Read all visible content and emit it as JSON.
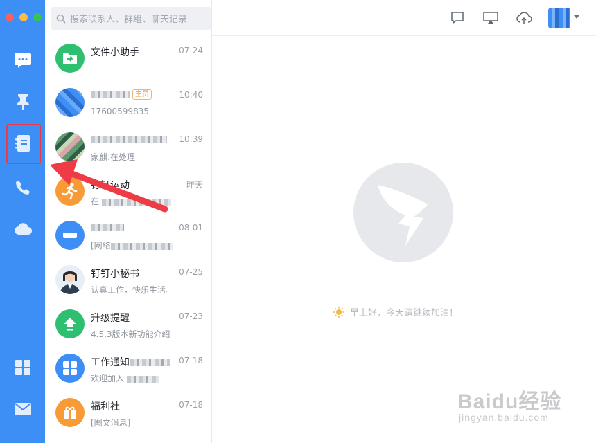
{
  "search": {
    "placeholder": "搜索联系人、群组、聊天记录"
  },
  "sidebar": {
    "items": [
      {
        "name": "messages",
        "icon": "chat-bubble-icon"
      },
      {
        "name": "ding",
        "icon": "pin-icon"
      },
      {
        "name": "contacts",
        "icon": "contacts-book-icon",
        "highlighted": true
      },
      {
        "name": "calls",
        "icon": "phone-icon"
      },
      {
        "name": "cloud",
        "icon": "cloud-icon"
      },
      {
        "name": "workbench",
        "icon": "grid-apps-icon"
      },
      {
        "name": "mail",
        "icon": "mail-icon"
      }
    ]
  },
  "conversations": [
    {
      "name": "文件小助手",
      "time": "07-24",
      "preview": "",
      "avatar": "file-transfer-icon",
      "color": "#2fbf71"
    },
    {
      "name": "",
      "tag": "主员",
      "time": "10:40",
      "preview": "17600599835",
      "avatar": "blurred-avatar",
      "color": "#3d8ef5"
    },
    {
      "name": "",
      "time": "10:39",
      "preview": "家麒:在处理",
      "avatar": "blurred-photo-avatar",
      "color": "#6aa36f"
    },
    {
      "name": "钉钉运动",
      "time": "昨天",
      "preview": "在",
      "avatar": "running-icon",
      "color": "#f89b36"
    },
    {
      "name": "",
      "time": "08-01",
      "preview": "[网络",
      "avatar": "blurred-avatar",
      "color": "#3d8ef5"
    },
    {
      "name": "钉钉小秘书",
      "time": "07-25",
      "preview": "认真工作，快乐生活。",
      "avatar": "assistant-photo-avatar",
      "color": "#2c3e50"
    },
    {
      "name": "升级提醒",
      "time": "07-23",
      "preview": "4.5.3版本新功能介绍",
      "avatar": "upgrade-arrow-icon",
      "color": "#2fbf71"
    },
    {
      "name": "工作通知",
      "time": "07-18",
      "preview": "欢迎加入",
      "avatar": "work-notice-icon",
      "color": "#3d8ef5"
    },
    {
      "name": "福利社",
      "time": "07-18",
      "preview": "[图文消息]",
      "avatar": "gift-icon",
      "color": "#f89b36"
    }
  ],
  "toolbar": {
    "icons": [
      "message-icon",
      "screen-cast-icon",
      "cloud-upload-icon"
    ]
  },
  "main": {
    "greeting": "早上好，今天请继续加油！"
  },
  "watermark": {
    "brand": "Baidu经验",
    "url": "jingyan.baidu.com"
  },
  "colors": {
    "sidebar": "#3d8ef5",
    "highlight": "#ea3b46",
    "green": "#2fbf71",
    "orange": "#f89b36"
  }
}
